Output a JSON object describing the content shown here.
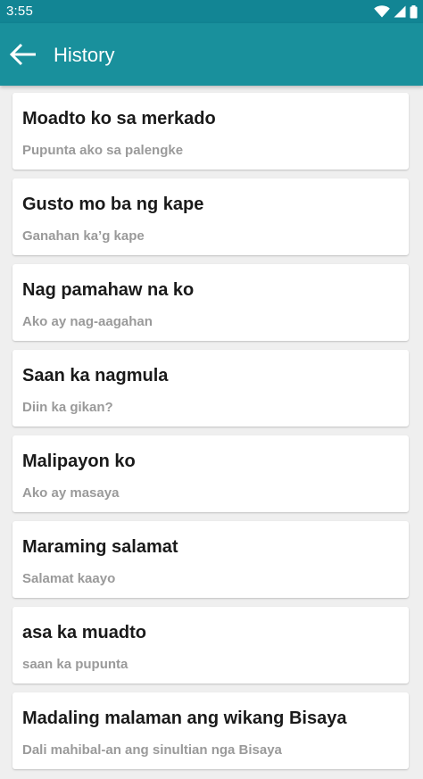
{
  "status_bar": {
    "time": "3:55",
    "icons": [
      "wifi-icon",
      "cell-signal-icon",
      "battery-icon"
    ]
  },
  "app_bar": {
    "title": "History",
    "back_icon": "arrow-back-icon"
  },
  "colors": {
    "status_bar": "#128594",
    "app_bar": "#19909c",
    "background": "#efefef",
    "card": "#ffffff",
    "title_text": "#1a1a1a",
    "subtitle_text": "#9a9a9a"
  },
  "history": {
    "items": [
      {
        "phrase": "Moadto ko sa merkado",
        "translation": "Pupunta ako sa palengke"
      },
      {
        "phrase": "Gusto mo ba ng kape",
        "translation": "Ganahan ka’g kape"
      },
      {
        "phrase": "Nag pamahaw na ko",
        "translation": "Ako ay nag-aagahan"
      },
      {
        "phrase": "Saan ka nagmula",
        "translation": "Diin ka gikan?"
      },
      {
        "phrase": "Malipayon ko",
        "translation": "Ako ay masaya"
      },
      {
        "phrase": "Maraming salamat",
        "translation": "Salamat kaayo"
      },
      {
        "phrase": "asa ka muadto",
        "translation": "saan ka pupunta"
      },
      {
        "phrase": "Madaling malaman ang wikang Bisaya",
        "translation": "Dali mahibal-an ang sinultian nga Bisaya"
      }
    ]
  }
}
